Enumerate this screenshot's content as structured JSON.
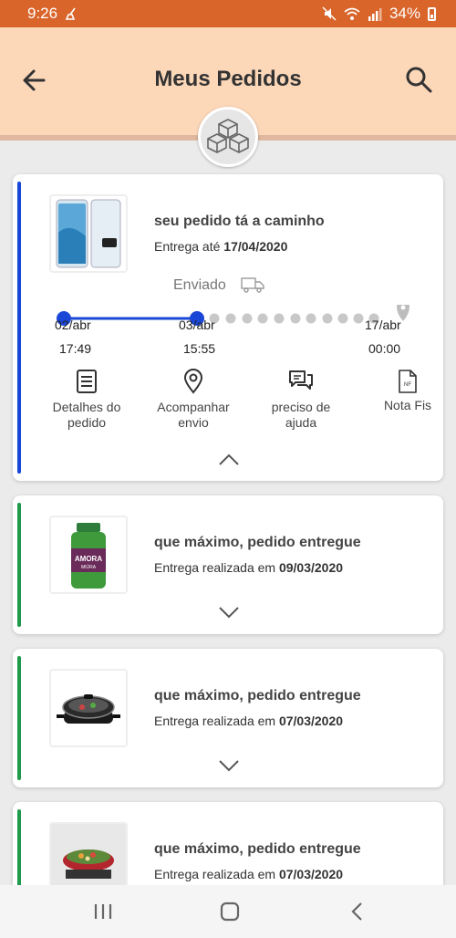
{
  "status_bar": {
    "time": "9:26",
    "battery": "34%"
  },
  "header": {
    "title": "Meus Pedidos"
  },
  "orders": [
    {
      "title": "seu pedido tá a caminho",
      "subtitle_prefix": "Entrega até",
      "subtitle_date": "17/04/2020",
      "stripe_color": "#1a47d6",
      "image": "smartphone",
      "tracking": {
        "status_label": "Enviado",
        "steps": [
          {
            "date": "02/abr",
            "time": "17:49"
          },
          {
            "date": "03/abr",
            "time": "15:55"
          },
          {
            "date": "17/abr",
            "time": "00:00"
          }
        ]
      },
      "actions": [
        {
          "label1": "Detalhes do",
          "label2": "pedido"
        },
        {
          "label1": "Acompanhar",
          "label2": "envio"
        },
        {
          "label1": "preciso de",
          "label2": "ajuda"
        },
        {
          "label1": "Nota Fis",
          "label2": ""
        }
      ]
    },
    {
      "title": "que máximo, pedido entregue",
      "subtitle_prefix": "Entrega realizada em",
      "subtitle_date": "09/03/2020",
      "stripe_color": "#1f9a4a",
      "image": "supplement-bottle"
    },
    {
      "title": "que máximo, pedido entregue",
      "subtitle_prefix": "Entrega realizada em",
      "subtitle_date": "07/03/2020",
      "stripe_color": "#1f9a4a",
      "image": "electric-skillet"
    },
    {
      "title": "que máximo, pedido entregue",
      "subtitle_prefix": "Entrega realizada em",
      "subtitle_date": "07/03/2020",
      "stripe_color": "#1f9a4a",
      "image": "wok-pan"
    }
  ],
  "colors": {
    "status_bar": "#d9652b",
    "header_bg": "#fcd7b8",
    "in_transit": "#1a47d6",
    "delivered": "#1f9a4a"
  }
}
